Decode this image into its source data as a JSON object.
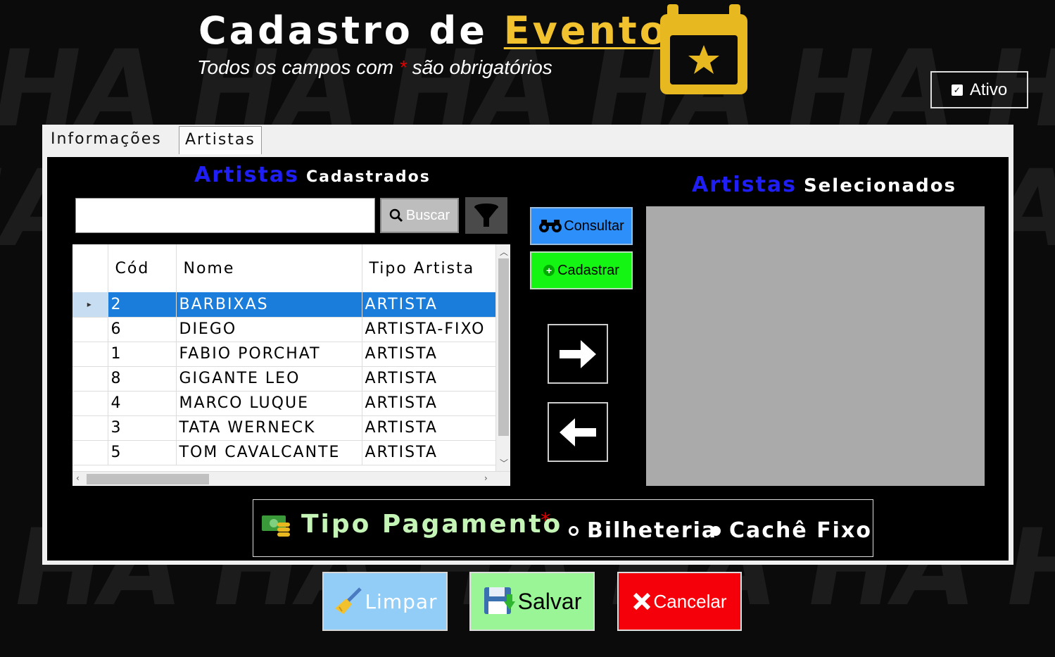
{
  "header": {
    "title_part1": "Cadastro de",
    "title_part2": "Eventos",
    "subtitle_part1": "Todos os campos com",
    "required_mark": "*",
    "subtitle_part2": "são obrigatórios"
  },
  "ativo": {
    "label": "Ativo",
    "checked": true
  },
  "tabs": [
    {
      "label": "Informações"
    },
    {
      "label": "Artistas",
      "selected": true
    }
  ],
  "cadastrados": {
    "title_accent": "Artistas",
    "title_rest": "Cadastrados"
  },
  "selecionados": {
    "title_accent": "Artistas",
    "title_rest": "Selecionados"
  },
  "search": {
    "value": "",
    "button_label": "Buscar"
  },
  "grid": {
    "columns": [
      "Cód",
      "Nome",
      "Tipo Artista"
    ],
    "rows": [
      {
        "cod": "2",
        "nome": "BARBIXAS",
        "tipo": "ARTISTA",
        "selected": true
      },
      {
        "cod": "6",
        "nome": "DIEGO",
        "tipo": "ARTISTA-FIXO"
      },
      {
        "cod": "1",
        "nome": "FABIO PORCHAT",
        "tipo": "ARTISTA"
      },
      {
        "cod": "8",
        "nome": "GIGANTE LEO",
        "tipo": "ARTISTA"
      },
      {
        "cod": "4",
        "nome": "MARCO LUQUE",
        "tipo": "ARTISTA"
      },
      {
        "cod": "3",
        "nome": "TATA WERNECK",
        "tipo": "ARTISTA"
      },
      {
        "cod": "5",
        "nome": "TOM CAVALCANTE",
        "tipo": "ARTISTA"
      }
    ]
  },
  "actions": {
    "consultar": "Consultar",
    "cadastrar": "Cadastrar"
  },
  "pagamento": {
    "label": "Tipo Pagamento",
    "required_mark": "*",
    "options": [
      {
        "label": "Bilheteria",
        "selected": false
      },
      {
        "label": "Cachê Fixo",
        "selected": true
      }
    ]
  },
  "footer": {
    "limpar": "Limpar",
    "salvar": "Salvar",
    "cancelar": "Cancelar"
  },
  "colors": {
    "accent_yellow": "#f2c12e",
    "blue_title": "#1f1ff5",
    "selection": "#1a7ddb",
    "consultar": "#2d8ffa",
    "cadastrar": "#14f514"
  },
  "icons": [
    "calendar-star-icon",
    "checkbox-icon",
    "search-icon",
    "filter-icon",
    "binoculars-icon",
    "plus-icon",
    "arrow-right-icon",
    "arrow-left-icon",
    "money-icon",
    "broom-icon",
    "save-icon",
    "close-icon"
  ]
}
